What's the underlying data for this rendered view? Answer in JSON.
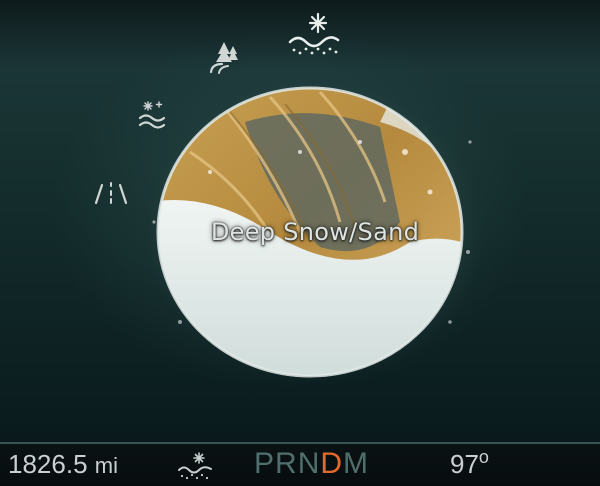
{
  "display": {
    "mode_title": "Deep Snow/Sand"
  },
  "mode_icons": [
    {
      "icon": "road-marks-icon",
      "selected": false
    },
    {
      "icon": "snowflake-waves-icon",
      "selected": false
    },
    {
      "icon": "trees-road-icon",
      "selected": false
    },
    {
      "icon": "deep-snow-sand-icon",
      "selected": true
    }
  ],
  "status_bar": {
    "odometer_value": "1826.5",
    "odometer_unit": "mi",
    "mode_icon": "deep-snow-sand-icon",
    "gears": [
      "P",
      "R",
      "N",
      "D",
      "M"
    ],
    "active_gear": "D",
    "temperature_value": "97",
    "temperature_unit": "o"
  },
  "colors": {
    "active_gear": "#e46a2a",
    "inactive_gear": "#4f6f6d",
    "text": "#c9d0cf",
    "sand": "#c89a4a",
    "snow": "#e7eeec"
  }
}
